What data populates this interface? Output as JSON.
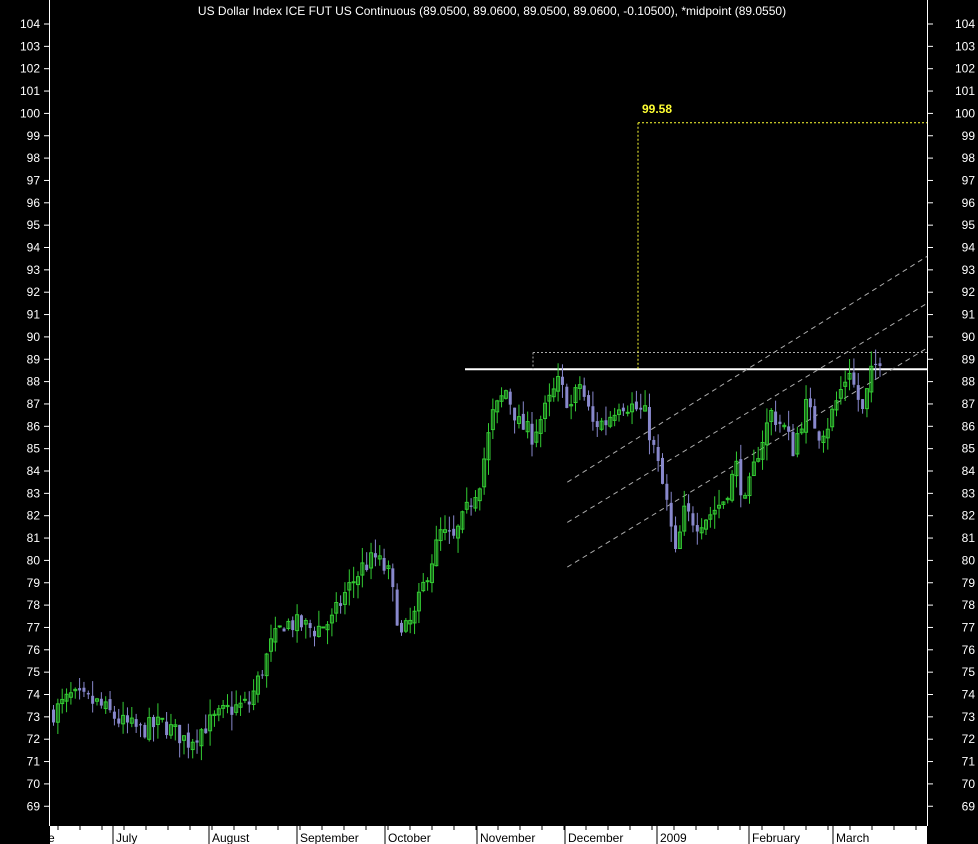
{
  "chart_data": {
    "type": "candlestick",
    "title": "US Dollar Index ICE FUT US Continuous (89.0500, 89.0600, 89.0500, 89.0600, -0.10500), *midpoint (89.0550)",
    "ylim": [
      68.2,
      104.8
    ],
    "y_ticks": [
      69,
      70,
      71,
      72,
      73,
      74,
      75,
      76,
      77,
      78,
      79,
      80,
      81,
      82,
      83,
      84,
      85,
      86,
      87,
      88,
      89,
      90,
      91,
      92,
      93,
      94,
      95,
      96,
      97,
      98,
      99,
      100,
      101,
      102,
      103,
      104
    ],
    "x_labels": [
      "e",
      "July",
      "August",
      "September",
      "October",
      "November",
      "December",
      "2009",
      "February",
      "March"
    ],
    "n_bars": 183,
    "colors": {
      "background": "#000000",
      "up": "#33cc33",
      "down": "#8888cc",
      "axis_bg": "#ffffff",
      "annotation": "#ffff33",
      "resistance": "#ffffff",
      "channel": "#aaaaaa"
    },
    "annotations": {
      "target_label": "99.58",
      "target_value": 99.58,
      "resistance_level": 88.55,
      "breakout_level": 89.3
    },
    "channel": {
      "start_bar": 118,
      "end_bar": 183,
      "upper_start": 83.5,
      "upper_end": 93.6,
      "middle_start": 81.7,
      "middle_end": 91.5,
      "lower_start": 79.7,
      "lower_end": 89.5
    },
    "waypoints": [
      [
        0,
        73.2
      ],
      [
        4,
        73.9
      ],
      [
        10,
        73.6
      ],
      [
        16,
        72.7
      ],
      [
        20,
        72.4
      ],
      [
        25,
        72.7
      ],
      [
        28,
        72.3
      ],
      [
        31,
        71.9
      ],
      [
        35,
        72.6
      ],
      [
        40,
        73.3
      ],
      [
        45,
        73.6
      ],
      [
        47,
        74.6
      ],
      [
        50,
        76.2
      ],
      [
        53,
        77.2
      ],
      [
        57,
        77.1
      ],
      [
        60,
        76.9
      ],
      [
        64,
        77.3
      ],
      [
        67,
        78.5
      ],
      [
        71,
        79.7
      ],
      [
        74,
        80.1
      ],
      [
        77,
        79.4
      ],
      [
        80,
        76.6
      ],
      [
        83,
        77.5
      ],
      [
        86,
        79.5
      ],
      [
        89,
        81.2
      ],
      [
        92,
        80.9
      ],
      [
        95,
        82.2
      ],
      [
        98,
        83.6
      ],
      [
        101,
        86.5
      ],
      [
        104,
        87.6
      ],
      [
        107,
        86.1
      ],
      [
        110,
        85.6
      ],
      [
        113,
        86.7
      ],
      [
        116,
        87.9
      ],
      [
        119,
        86.9
      ],
      [
        121,
        87.9
      ],
      [
        124,
        86.1
      ],
      [
        127,
        86.2
      ],
      [
        130,
        87.1
      ],
      [
        133,
        86.9
      ],
      [
        136,
        86.5
      ],
      [
        139,
        84.2
      ],
      [
        141,
        82.5
      ],
      [
        143,
        80.2
      ],
      [
        145,
        82.1
      ],
      [
        148,
        81.7
      ],
      [
        151,
        82.1
      ],
      [
        154,
        82.7
      ],
      [
        157,
        84.2
      ],
      [
        159,
        82.5
      ],
      [
        162,
        84.9
      ],
      [
        165,
        86.6
      ],
      [
        168,
        85.9
      ],
      [
        170,
        85.0
      ],
      [
        173,
        86.9
      ],
      [
        176,
        85.7
      ],
      [
        178,
        86.1
      ],
      [
        181,
        87.6
      ],
      [
        183,
        88.6
      ],
      [
        184,
        87.8
      ],
      [
        186,
        86.6
      ],
      [
        188,
        88.3
      ],
      [
        190,
        89.1
      ]
    ]
  }
}
